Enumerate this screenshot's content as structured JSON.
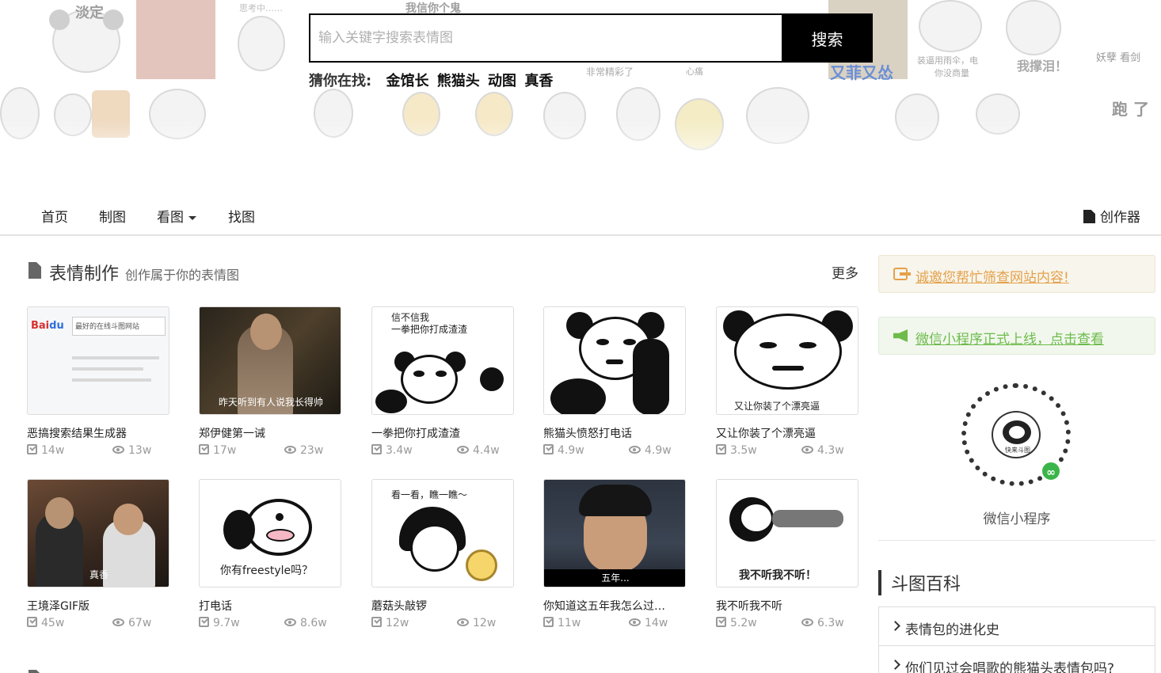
{
  "hero": {
    "collage_captions": [
      "淡定",
      "思考中……",
      "我信你个鬼",
      "装逼用雨伞，电",
      "你没商量",
      "妖孽 看剑",
      "非常精彩了",
      "我撑泪！",
      "跑 了",
      "又菲又怂",
      "心痛"
    ],
    "search": {
      "placeholder": "输入关键字搜索表情图",
      "button_label": "搜索"
    },
    "guess": {
      "label": "猜你在找:",
      "keywords": [
        "金馆长",
        "熊猫头",
        "动图",
        "真香"
      ]
    }
  },
  "navbar": {
    "items": [
      "首页",
      "制图",
      "看图",
      "找图"
    ],
    "creator_label": "创作器"
  },
  "make_section": {
    "title": "表情制作",
    "subtitle": "创作属于你的表情图",
    "more_label": "更多",
    "cards": [
      {
        "title": "恶搞搜索结果生成器",
        "edits": "14w",
        "views": "13w",
        "thumb_text": "最好的在线斗图网站"
      },
      {
        "title": "郑伊健第一诫",
        "edits": "17w",
        "views": "23w",
        "thumb_text": "昨天听到有人说我长得帅"
      },
      {
        "title": "一拳把你打成渣渣",
        "edits": "3.4w",
        "views": "4.4w",
        "thumb_text": "信不信我\n一拳把你打成渣渣"
      },
      {
        "title": "熊猫头愤怒打电话",
        "edits": "4.9w",
        "views": "4.9w",
        "thumb_text": ""
      },
      {
        "title": "又让你装了个漂亮逼",
        "edits": "3.5w",
        "views": "4.3w",
        "thumb_text": "又让你装了个漂亮逼"
      },
      {
        "title": "王境泽GIF版",
        "edits": "45w",
        "views": "67w",
        "thumb_text": "真香"
      },
      {
        "title": "打电话",
        "edits": "9.7w",
        "views": "8.6w",
        "thumb_text": "你有freestyle吗？"
      },
      {
        "title": "蘑菇头敲锣",
        "edits": "12w",
        "views": "12w",
        "thumb_text": "看一看，瞧一瞧～"
      },
      {
        "title": "你知道这五年我怎么过…",
        "edits": "11w",
        "views": "14w",
        "thumb_text": "五年..."
      },
      {
        "title": "我不听我不听",
        "edits": "5.2w",
        "views": "6.3w",
        "thumb_text": "我不听我不听！"
      }
    ]
  },
  "sidebar": {
    "notice_1": "诚邀您帮忙筛查网站内容!",
    "notice_2": "微信小程序正式上线，点击查看",
    "qr_center_text": "快来斗图",
    "qr_label": "微信小程序",
    "wiki": {
      "title": "斗图百科",
      "items": [
        "表情包的进化史",
        "你们见过会唱歌的熊猫头表情包吗?"
      ]
    }
  },
  "colors": {
    "notice_orange": "#e5a14b",
    "notice_green": "#6dbb4a",
    "search_button": "#000000"
  }
}
